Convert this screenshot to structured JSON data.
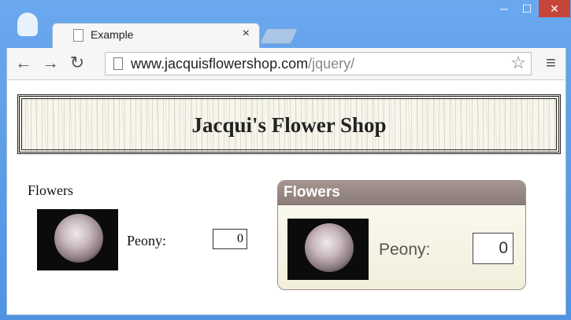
{
  "browser": {
    "tab_title": "Example",
    "url_host": "www.jacquisflowershop.com",
    "url_path": "/jquery/",
    "tab_close": "×",
    "win_min": "─",
    "win_max": "☐",
    "win_close": "✕",
    "back": "←",
    "forward": "→",
    "reload": "↻",
    "star": "☆",
    "menu": "≡"
  },
  "page": {
    "banner_title": "Jacqui's Flower Shop",
    "plain_section": {
      "heading": "Flowers",
      "label": "Peony:",
      "value": "0"
    },
    "styled_section": {
      "heading": "Flowers",
      "label": "Peony:",
      "value": "0"
    }
  },
  "icons": [
    "ghost-user-icon",
    "page-icon",
    "back-arrow-icon",
    "forward-arrow-icon",
    "reload-icon",
    "bookmark-star-icon",
    "menu-icon",
    "close-icon"
  ],
  "colors": {
    "frame": "#5a9be6",
    "panel_header": "#8c7c78",
    "close_button": "#c6453a"
  }
}
